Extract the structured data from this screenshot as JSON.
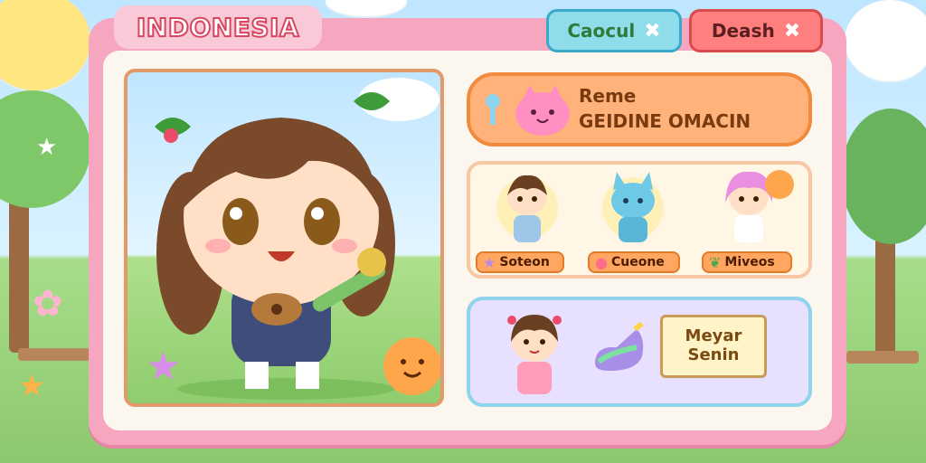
{
  "header": {
    "title": "INDONESIA"
  },
  "buttons": {
    "cancel_label": "Caocul",
    "death_label": "Deash",
    "close_glyph": "✖"
  },
  "featured": {
    "line1": "Reme",
    "line2": "GEIDINE OMACIN"
  },
  "characters": [
    {
      "label": "Soteon",
      "icon": "star-icon"
    },
    {
      "label": "Cueone",
      "icon": "gem-icon"
    },
    {
      "label": "Miveos",
      "icon": "leaf-icon"
    }
  ],
  "speech": {
    "line1": "Meyar",
    "line2": "Senin"
  },
  "colors": {
    "frame": "#f7a6c0",
    "title_stroke": "#d8455e",
    "cancel_bg": "#8fdcea",
    "death_bg": "#ff7f7f",
    "featured_bg": "#ffb37a"
  }
}
